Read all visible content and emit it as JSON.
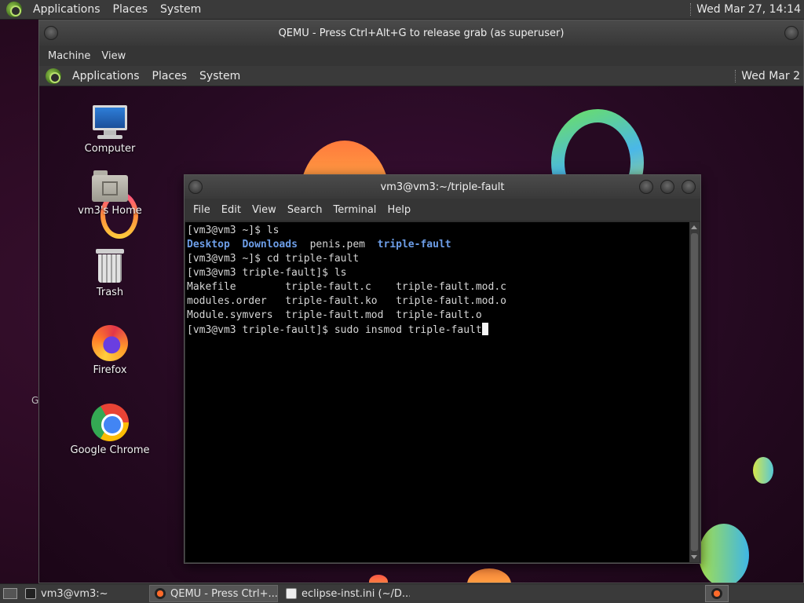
{
  "host_panel": {
    "menus": [
      "Applications",
      "Places",
      "System"
    ],
    "clock": "Wed Mar 27, 14:14"
  },
  "host_desktop": {
    "partial_label": "G"
  },
  "qemu": {
    "title": "QEMU - Press Ctrl+Alt+G to release grab (as superuser)",
    "menus": [
      "Machine",
      "View"
    ]
  },
  "guest_panel": {
    "menus": [
      "Applications",
      "Places",
      "System"
    ],
    "clock": "Wed Mar 2"
  },
  "desktop_icons": [
    {
      "label": "Computer",
      "icon": "computer-icon"
    },
    {
      "label": "vm3's Home",
      "icon": "home-folder-icon"
    },
    {
      "label": "Trash",
      "icon": "trash-icon"
    },
    {
      "label": "Firefox",
      "icon": "firefox-icon"
    },
    {
      "label": "Google Chrome",
      "icon": "chrome-icon"
    }
  ],
  "terminal": {
    "title": "vm3@vm3:~/triple-fault",
    "menus": [
      "File",
      "Edit",
      "View",
      "Search",
      "Terminal",
      "Help"
    ],
    "lines": {
      "l1": "[vm3@vm3 ~]$ ls",
      "l2_dir1": "Desktop",
      "l2_dir2": "Downloads",
      "l2_file": "penis.pem",
      "l2_dir3": "triple-fault",
      "l3": "[vm3@vm3 ~]$ cd triple-fault",
      "l4": "[vm3@vm3 triple-fault]$ ls",
      "l5": "Makefile        triple-fault.c    triple-fault.mod.c",
      "l6": "modules.order   triple-fault.ko   triple-fault.mod.o",
      "l7": "Module.symvers  triple-fault.mod  triple-fault.o",
      "l8": "[vm3@vm3 triple-fault]$ sudo insmod triple-fault"
    }
  },
  "taskbar": {
    "tasks": [
      {
        "label": "vm3@vm3:~",
        "icon": "terminal-icon"
      },
      {
        "label": "QEMU - Press Ctrl+...",
        "icon": "qemu-icon"
      },
      {
        "label": "eclipse-inst.ini (~/D...",
        "icon": "text-editor-icon"
      }
    ]
  },
  "colors": {
    "directory": "#6d9ee8",
    "panel": "#3a3a3a",
    "terminal_bg": "#000000"
  }
}
